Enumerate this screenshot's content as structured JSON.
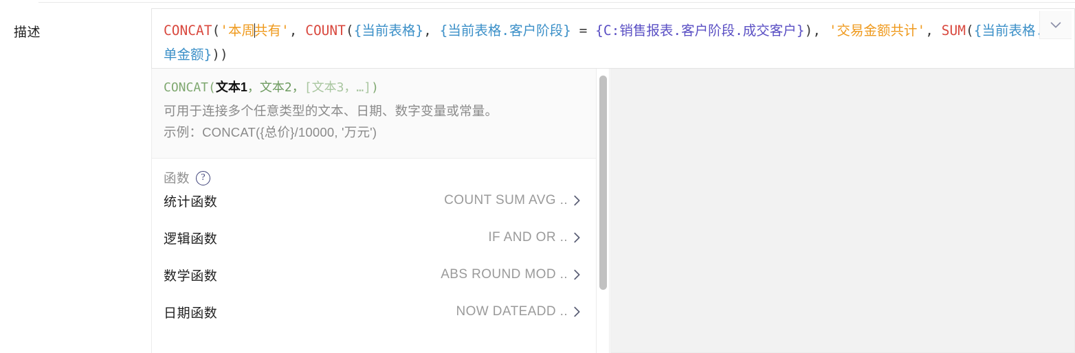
{
  "field": {
    "label": "描述"
  },
  "formula_editor": {
    "collapse_icon": "chevron-down-icon",
    "tokens": [
      {
        "t": "CONCAT",
        "c": "fn"
      },
      {
        "t": "(",
        "c": "punc"
      },
      {
        "t": "'本周",
        "c": "str"
      },
      {
        "t": "CARET",
        "c": "caret"
      },
      {
        "t": "共有'",
        "c": "str"
      },
      {
        "t": ",",
        "c": "punc"
      },
      {
        "t": " ",
        "c": "punc"
      },
      {
        "t": "COUNT",
        "c": "fn"
      },
      {
        "t": "(",
        "c": "punc"
      },
      {
        "t": "{当前表格}",
        "c": "fieldref"
      },
      {
        "t": ",",
        "c": "punc"
      },
      {
        "t": " ",
        "c": "punc"
      },
      {
        "t": "{当前表格.客户阶段}",
        "c": "fieldref"
      },
      {
        "t": " = ",
        "c": "op"
      },
      {
        "t": "{C:销售报表.客户阶段.成交客户}",
        "c": "ctrlref"
      },
      {
        "t": ")",
        "c": "punc"
      },
      {
        "t": ",",
        "c": "punc"
      },
      {
        "t": " ",
        "c": "punc"
      },
      {
        "t": "'交易金额共计'",
        "c": "str"
      },
      {
        "t": ",",
        "c": "punc"
      },
      {
        "t": " ",
        "c": "punc"
      },
      {
        "t": "SUM",
        "c": "fn"
      },
      {
        "t": "(",
        "c": "punc"
      },
      {
        "t": "{当前表格.成单金额}",
        "c": "fieldref"
      },
      {
        "t": ")",
        "c": "punc"
      },
      {
        "t": ")",
        "c": "punc"
      }
    ],
    "plain_text": "CONCAT('本周共有', COUNT({当前表格}, {当前表格.客户阶段} = {C:销售报表.客户阶段.成交客户}), '交易金额共计', SUM({当前表格.成单金额}))"
  },
  "function_help": {
    "signature": {
      "name": "CONCAT",
      "open": "(",
      "arg_active": "文本1",
      "sep1": "，",
      "arg2": "文本2",
      "sep2": "，",
      "optional": "[文本3，…]",
      "close": ")"
    },
    "description": "可用于连接多个任意类型的文本、日期、数字变量或常量。",
    "example": "示例：CONCAT({总价}/10000, '万元')"
  },
  "function_list": {
    "title": "函数",
    "help_icon": "question-mark-icon",
    "rows": [
      {
        "category": "统计函数",
        "preview": "COUNT SUM AVG ..",
        "chevron": "chevron-right-icon"
      },
      {
        "category": "逻辑函数",
        "preview": "IF AND OR ..",
        "chevron": "chevron-right-icon"
      },
      {
        "category": "数学函数",
        "preview": "ABS ROUND MOD ..",
        "chevron": "chevron-right-icon"
      },
      {
        "category": "日期函数",
        "preview": "NOW DATEADD ..",
        "chevron": "chevron-right-icon"
      }
    ]
  },
  "colors": {
    "function_token": "#d9493f",
    "string_token": "#ef9a1e",
    "field_token": "#3c90c8",
    "control_token": "#5a4fc4",
    "help_text": "#7fa870",
    "muted": "#9a9a9a",
    "accent": "#3b3f77"
  }
}
